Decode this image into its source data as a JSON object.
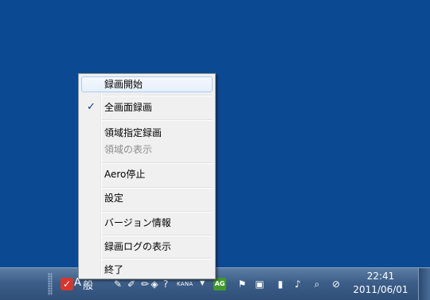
{
  "menu": {
    "items": [
      {
        "label": "録画開始",
        "highlighted": true
      },
      {
        "label": "全画面録画",
        "checked": true
      },
      {
        "label": "領域指定録画"
      },
      {
        "label": "領域の表示",
        "disabled": true
      },
      {
        "label": "Aero停止"
      },
      {
        "label": "設定"
      },
      {
        "label": "バージョン情報"
      },
      {
        "label": "録画ログの表示"
      },
      {
        "label": "終了"
      }
    ],
    "check_glyph": "✓"
  },
  "taskbar": {
    "ime_mode": "A",
    "ime_input": "般",
    "kana_label": "KANA",
    "ag_icon_label": "AG",
    "app_icon_glyph": "⊘",
    "clock_time": "22:41",
    "clock_date": "2011/06/01"
  },
  "colors": {
    "desktop": "#0b4a93",
    "menu_bg": "#f0f0f0",
    "highlight_border": "#aeccf1",
    "taskbar": "#3c5e88"
  }
}
